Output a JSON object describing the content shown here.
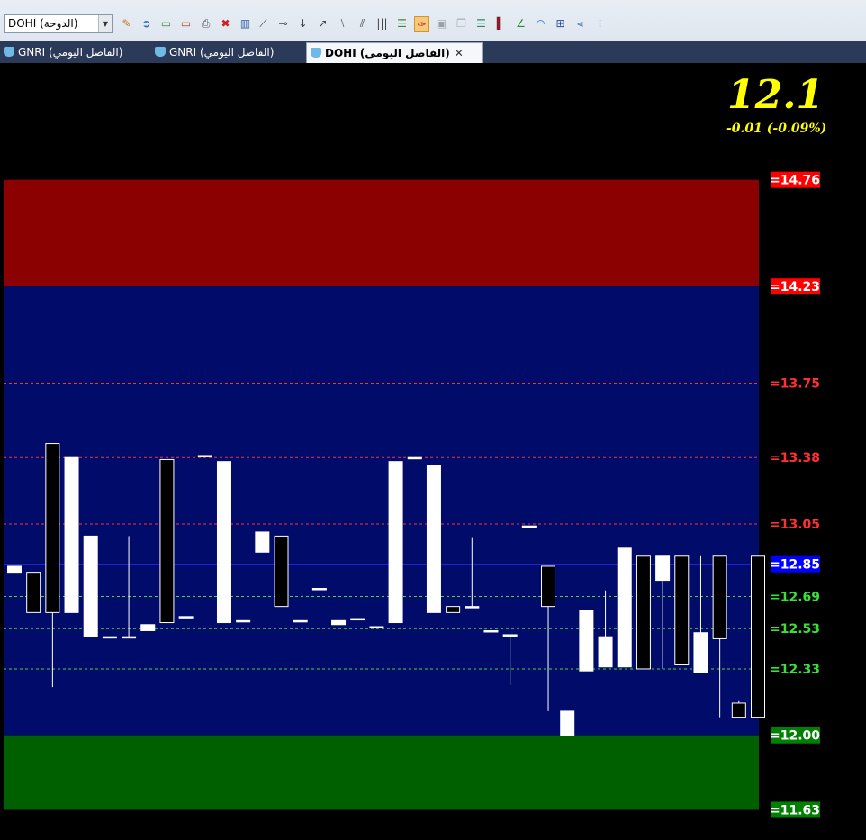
{
  "toolbar": {
    "symbol_value": "DOHI (الدوحة)",
    "icons": [
      {
        "name": "wand-icon",
        "glyph": "✎",
        "color": "#c07a2a"
      },
      {
        "name": "import-icon",
        "glyph": "➲",
        "color": "#2a6fb8"
      },
      {
        "name": "add-chart-icon",
        "glyph": "▭",
        "color": "#3a8a3a"
      },
      {
        "name": "remove-chart-icon",
        "glyph": "▭",
        "color": "#c04020"
      },
      {
        "name": "print-icon",
        "glyph": "⎙",
        "color": "#555555"
      },
      {
        "name": "delete-icon",
        "glyph": "✖",
        "color": "#d02020"
      },
      {
        "name": "bar-chart-icon",
        "glyph": "▥",
        "color": "#2a5fa8"
      },
      {
        "name": "trend-line-icon",
        "glyph": "⟋",
        "color": "#444444"
      },
      {
        "name": "horizontal-line-icon",
        "glyph": "⊸",
        "color": "#444444"
      },
      {
        "name": "vertical-line-icon",
        "glyph": "↓",
        "color": "#444444"
      },
      {
        "name": "ray-icon",
        "glyph": "↗",
        "color": "#444444"
      },
      {
        "name": "parallel-lines-icon",
        "glyph": "⧵",
        "color": "#444444"
      },
      {
        "name": "channel-icon",
        "glyph": "⫽",
        "color": "#444444"
      },
      {
        "name": "vertical-lines-icon",
        "glyph": "|||",
        "color": "#444444"
      },
      {
        "name": "levels-icon",
        "glyph": "☰",
        "color": "#3a8a3a"
      },
      {
        "name": "pin-icon",
        "glyph": "✑",
        "color": "#c02020"
      },
      {
        "name": "window-icon",
        "glyph": "▣",
        "color": "#9aa0a8"
      },
      {
        "name": "copy-icon",
        "glyph": "❐",
        "color": "#9aa0a8"
      },
      {
        "name": "fibonacci-icon",
        "glyph": "☰",
        "color": "#2a8a5a"
      },
      {
        "name": "volume-bars-icon",
        "glyph": "▍",
        "color": "#8a1a2a"
      },
      {
        "name": "fan-icon",
        "glyph": "∠",
        "color": "#2a8a2a"
      },
      {
        "name": "arc-icon",
        "glyph": "◠",
        "color": "#2a70c0"
      },
      {
        "name": "grid-icon",
        "glyph": "⊞",
        "color": "#2a50a0"
      },
      {
        "name": "gann-fan-icon",
        "glyph": "⫷",
        "color": "#2a70c0"
      },
      {
        "name": "cycle-lines-icon",
        "glyph": "⁝",
        "color": "#2a70c0"
      }
    ]
  },
  "tabs": [
    {
      "label": "GNRI (الفاصل اليومي)",
      "active": false
    },
    {
      "label": "GNRI (الفاصل اليومي)",
      "active": false
    },
    {
      "label": "DOHI (الفاصل اليومي)",
      "active": true
    }
  ],
  "quote": {
    "last_price": "12.1",
    "change": "-0.01  (-0.09%)"
  },
  "colors": {
    "zone_top": "#8b0000",
    "zone_mid": "#000b6a",
    "zone_bottom": "#006000",
    "resistance": "#ff3030",
    "support": "#38e038",
    "current": "#2a2aff",
    "candle_up": "#ffffff",
    "candle_down": "#000000"
  },
  "chart_data": {
    "type": "candlestick",
    "y_range": [
      11.48,
      15.34
    ],
    "zones": [
      {
        "name": "upper",
        "from": 14.23,
        "to": 14.76,
        "color": "#8b0000"
      },
      {
        "name": "middle",
        "from": 12.0,
        "to": 14.23,
        "color": "#000b6a"
      },
      {
        "name": "lower",
        "from": 11.63,
        "to": 12.0,
        "color": "#006000"
      }
    ],
    "levels": [
      {
        "value": 14.76,
        "label": "=14.76",
        "kind": "zone",
        "color": "#ff0000"
      },
      {
        "value": 14.23,
        "label": "=14.23",
        "kind": "zone",
        "color": "#ff0000"
      },
      {
        "value": 13.75,
        "label": "=13.75",
        "kind": "resistance",
        "color": "#ff3030"
      },
      {
        "value": 13.38,
        "label": "=13.38",
        "kind": "resistance",
        "color": "#ff3030"
      },
      {
        "value": 13.05,
        "label": "=13.05",
        "kind": "resistance",
        "color": "#ff3030"
      },
      {
        "value": 12.85,
        "label": "=12.85",
        "kind": "current",
        "color": "#0000ff"
      },
      {
        "value": 12.69,
        "label": "=12.69",
        "kind": "support",
        "color": "#38e038"
      },
      {
        "value": 12.53,
        "label": "=12.53",
        "kind": "support",
        "color": "#38e038"
      },
      {
        "value": 12.33,
        "label": "=12.33",
        "kind": "support",
        "color": "#38e038"
      },
      {
        "value": 12.0,
        "label": "=12.00",
        "kind": "zone",
        "color": "#008000"
      },
      {
        "value": 11.63,
        "label": "=11.63",
        "kind": "zone",
        "color": "#008000"
      }
    ],
    "candles": [
      {
        "open": 12.81,
        "high": 12.81,
        "low": 12.81,
        "close": 12.84
      },
      {
        "open": 12.81,
        "high": 12.81,
        "low": 12.61,
        "close": 12.61
      },
      {
        "open": 13.45,
        "high": 13.45,
        "low": 12.24,
        "close": 12.61
      },
      {
        "open": 12.61,
        "high": 13.38,
        "low": 12.61,
        "close": 13.38
      },
      {
        "open": 12.49,
        "high": 12.99,
        "low": 12.49,
        "close": 12.99
      },
      {
        "open": 12.49,
        "high": 12.49,
        "low": 12.49,
        "close": 12.49
      },
      {
        "open": 12.49,
        "high": 12.99,
        "low": 12.49,
        "close": 12.49
      },
      {
        "open": 12.52,
        "high": 12.52,
        "low": 12.52,
        "close": 12.55
      },
      {
        "open": 13.37,
        "high": 13.37,
        "low": 12.56,
        "close": 12.56
      },
      {
        "open": 12.59,
        "high": 12.59,
        "low": 12.59,
        "close": 12.59
      },
      {
        "open": 13.39,
        "high": 13.39,
        "low": 13.39,
        "close": 13.39
      },
      {
        "open": 12.56,
        "high": 13.36,
        "low": 12.56,
        "close": 13.36
      },
      {
        "open": 12.57,
        "high": 12.57,
        "low": 12.57,
        "close": 12.57
      },
      {
        "open": 12.91,
        "high": 12.91,
        "low": 12.91,
        "close": 13.01
      },
      {
        "open": 12.99,
        "high": 12.99,
        "low": 12.64,
        "close": 12.64
      },
      {
        "open": 12.57,
        "high": 12.57,
        "low": 12.57,
        "close": 12.57
      },
      {
        "open": 12.73,
        "high": 12.73,
        "low": 12.73,
        "close": 12.73
      },
      {
        "open": 12.55,
        "high": 12.55,
        "low": 12.55,
        "close": 12.57
      },
      {
        "open": 12.58,
        "high": 12.58,
        "low": 12.58,
        "close": 12.58
      },
      {
        "open": 12.54,
        "high": 12.54,
        "low": 12.54,
        "close": 12.54
      },
      {
        "open": 12.56,
        "high": 13.36,
        "low": 12.56,
        "close": 13.36
      },
      {
        "open": 13.38,
        "high": 13.38,
        "low": 13.38,
        "close": 13.38
      },
      {
        "open": 12.61,
        "high": 13.34,
        "low": 12.61,
        "close": 13.34
      },
      {
        "open": 12.64,
        "high": 12.64,
        "low": 12.61,
        "close": 12.61
      },
      {
        "open": 12.64,
        "high": 12.98,
        "low": 12.64,
        "close": 12.64
      },
      {
        "open": 12.52,
        "high": 12.52,
        "low": 12.52,
        "close": 12.52
      },
      {
        "open": 12.5,
        "high": 12.5,
        "low": 12.25,
        "close": 12.5
      },
      {
        "open": 13.04,
        "high": 13.04,
        "low": 13.04,
        "close": 13.04
      },
      {
        "open": 12.84,
        "high": 12.84,
        "low": 12.12,
        "close": 12.64
      },
      {
        "open": 12.0,
        "high": 12.12,
        "low": 12.0,
        "close": 12.12
      },
      {
        "open": 12.32,
        "high": 12.62,
        "low": 12.32,
        "close": 12.62
      },
      {
        "open": 12.34,
        "high": 12.72,
        "low": 12.34,
        "close": 12.49
      },
      {
        "open": 12.34,
        "high": 12.93,
        "low": 12.34,
        "close": 12.93
      },
      {
        "open": 12.89,
        "high": 12.89,
        "low": 12.33,
        "close": 12.33
      },
      {
        "open": 12.77,
        "high": 12.89,
        "low": 12.33,
        "close": 12.89
      },
      {
        "open": 12.89,
        "high": 12.89,
        "low": 12.35,
        "close": 12.35
      },
      {
        "open": 12.31,
        "high": 12.89,
        "low": 12.31,
        "close": 12.51
      },
      {
        "open": 12.89,
        "high": 12.89,
        "low": 12.09,
        "close": 12.48
      },
      {
        "open": 12.16,
        "high": 12.17,
        "low": 12.09,
        "close": 12.09
      },
      {
        "open": 12.89,
        "high": 12.89,
        "low": 12.09,
        "close": 12.09
      }
    ]
  }
}
